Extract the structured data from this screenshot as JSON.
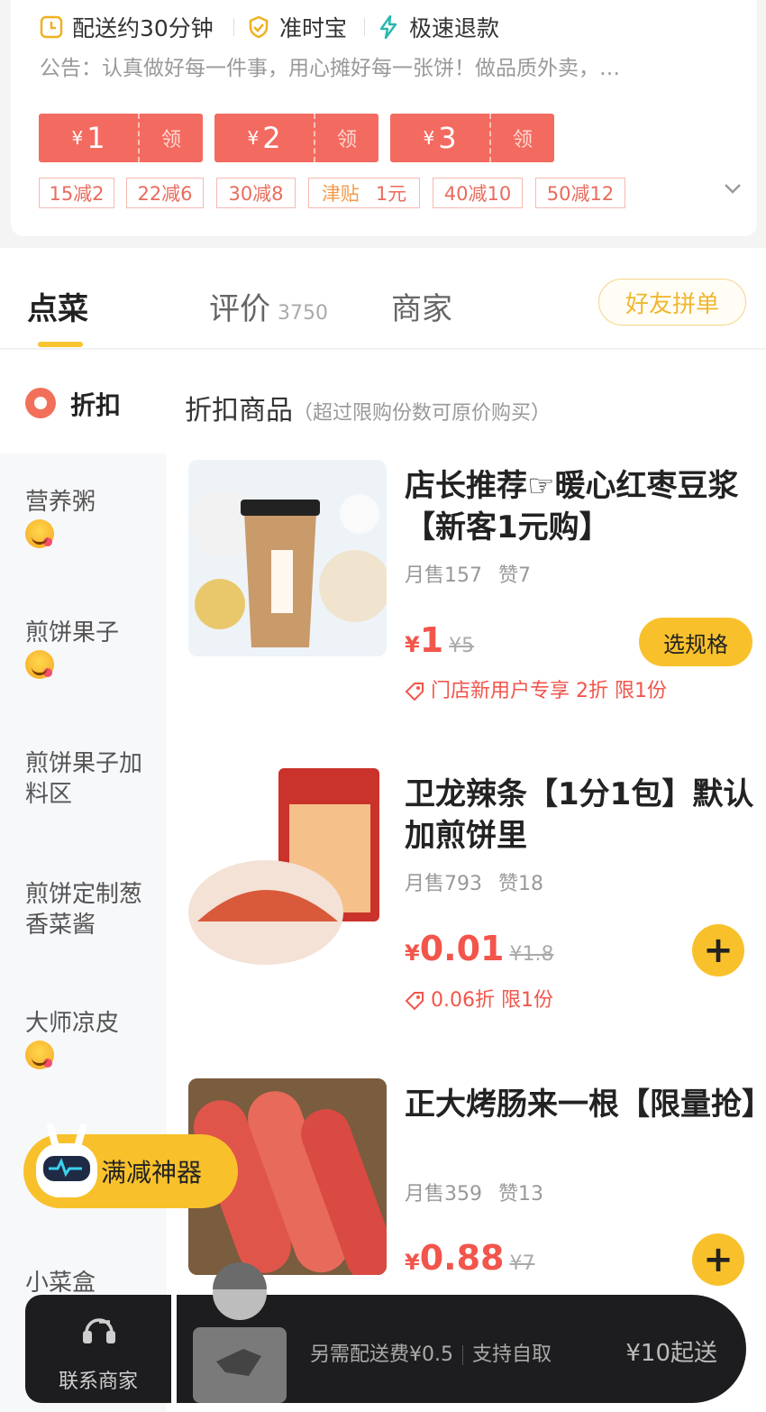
{
  "header": {
    "perks": [
      {
        "icon": "clock-icon",
        "label": "配送约30分钟"
      },
      {
        "icon": "shield-check-icon",
        "label": "准时宝"
      },
      {
        "icon": "lightning-icon",
        "label": "极速退款"
      }
    ],
    "notice": "公告：认真做好每一件事，用心摊好每一张饼！做品质外卖，…",
    "coupons": [
      {
        "currency": "¥",
        "amount": "1",
        "action": "领"
      },
      {
        "currency": "¥",
        "amount": "2",
        "action": "领"
      },
      {
        "currency": "¥",
        "amount": "3",
        "action": "领"
      }
    ],
    "promos": [
      "15减2",
      "22减6",
      "30减8",
      "40减10",
      "50减12"
    ],
    "subsidy": {
      "label": "津贴",
      "value": "1元"
    }
  },
  "tabs": {
    "order": "点菜",
    "reviews": "评价",
    "reviews_count": "3750",
    "merchant": "商家",
    "group_order": "好友拼单"
  },
  "sidebar": {
    "active": "折扣",
    "items": [
      {
        "label": "营养粥",
        "emoji": true
      },
      {
        "label": "煎饼果子",
        "emoji": true
      },
      {
        "label": "煎饼果子加料区",
        "emoji": false
      },
      {
        "label": "煎饼定制葱香菜酱",
        "emoji": false
      },
      {
        "label": "大师凉皮",
        "emoji": true
      },
      {
        "label": "小菜盒",
        "emoji": true
      }
    ]
  },
  "section": {
    "title": "折扣商品",
    "note": "（超过限购份数可原价购买）"
  },
  "products": [
    {
      "name": "店长推荐☞暖心红枣豆浆【新客1元购】",
      "sales": "月售157",
      "likes": "赞7",
      "currency": "¥",
      "price": "1",
      "orig": "¥5",
      "discount": "门店新用户专享 2折 限1份",
      "action": "选规格"
    },
    {
      "name": "卫龙辣条【1分1包】默认加煎饼里",
      "sales": "月售793",
      "likes": "赞18",
      "currency": "¥",
      "price": "0.01",
      "orig": "¥1.8",
      "discount": "0.06折 限1份",
      "action": "+"
    },
    {
      "name": "正大烤肠来一根【限量抢】",
      "sales": "月售359",
      "likes": "赞13",
      "currency": "¥",
      "price": "0.88",
      "orig": "¥7",
      "action": "+"
    }
  ],
  "floating": {
    "label": "满减神器"
  },
  "bottom": {
    "contact": "联系商家",
    "delivery_fee": "另需配送费¥0.5",
    "pickup": "支持自取",
    "min_order": "¥10起送"
  },
  "colors": {
    "accent": "#f8c12c",
    "price": "#f2554b",
    "coupon": "#f36b60"
  }
}
